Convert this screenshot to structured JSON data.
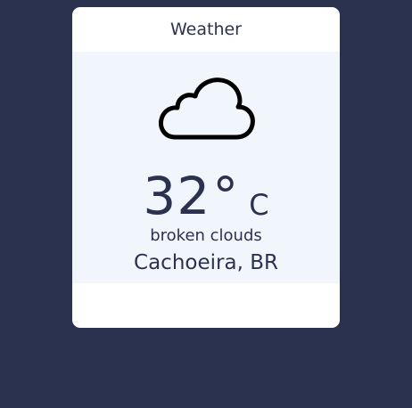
{
  "card": {
    "title": "Weather"
  },
  "weather": {
    "icon": "cloud-icon",
    "temperature": "32",
    "degree_symbol": "°",
    "unit": "C",
    "description": "broken clouds",
    "location": "Cachoeira, BR"
  },
  "colors": {
    "page_background": "#2b3250",
    "card_background": "#ffffff",
    "card_body_background": "#f1f6fd",
    "text": "#2b3250",
    "icon_stroke": "#000000"
  }
}
